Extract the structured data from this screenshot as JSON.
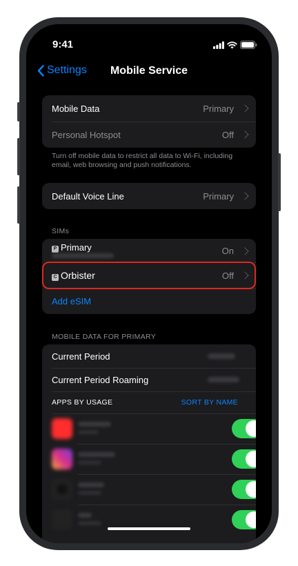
{
  "status_bar": {
    "time": "9:41"
  },
  "nav": {
    "back_label": "Settings",
    "title": "Mobile Service"
  },
  "group1": {
    "rows": [
      {
        "label": "Mobile Data",
        "value": "Primary"
      },
      {
        "label": "Personal Hotspot",
        "value": "Off"
      }
    ],
    "footnote": "Turn off mobile data to restrict all data to Wi-Fi, including email, web browsing and push notifications."
  },
  "group2": {
    "label": "Default Voice Line",
    "value": "Primary"
  },
  "sims": {
    "header": "SIMs",
    "primary": {
      "badge": "P",
      "label": "Primary",
      "value": "On"
    },
    "orbister": {
      "badge": "C",
      "label": "Orbister",
      "value": "Off"
    },
    "add_esim": "Add eSIM"
  },
  "usage": {
    "header": "MOBILE DATA FOR PRIMARY",
    "current_period": "Current Period",
    "current_period_roaming": "Current Period Roaming",
    "apps_by_usage": "APPS BY USAGE",
    "sort_by_name": "SORT BY NAME",
    "apps": [
      {
        "icon_color": "#ff2d2d",
        "enabled": true
      },
      {
        "icon_color": "#d62f8c",
        "enabled": true
      },
      {
        "icon_color": "#1a1a1a",
        "enabled": true
      },
      {
        "icon_color": "#2a2a2a",
        "enabled": true
      }
    ]
  }
}
